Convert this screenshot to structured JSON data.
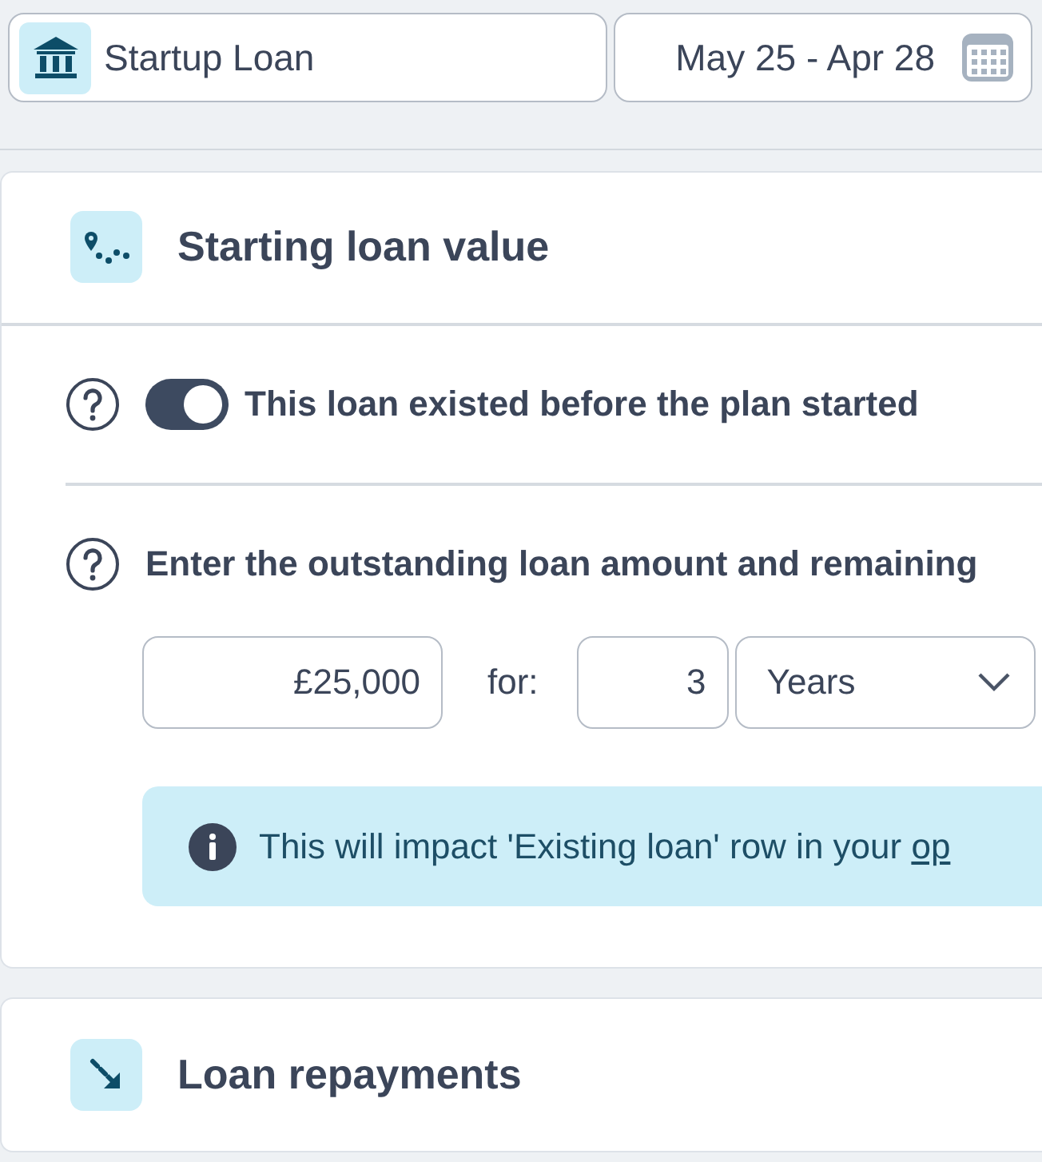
{
  "loan_selector": {
    "label": "Startup Loan"
  },
  "date_range": {
    "label": "May 25 - Apr 28"
  },
  "sections": [
    {
      "kind": "start",
      "title": "Starting loan value",
      "existing_toggle": {
        "label": "This loan existed before the plan started",
        "on": true
      },
      "amount_prompt": "Enter the outstanding loan amount and remaining",
      "amount": {
        "value": "£25,000"
      },
      "for_label": "for:",
      "term": {
        "value": "3"
      },
      "term_unit": {
        "value": "Years"
      },
      "info": {
        "text": "This will impact 'Existing loan' row in your",
        "link": "op"
      }
    },
    {
      "kind": "repayments",
      "title": "Loan repayments"
    }
  ]
}
